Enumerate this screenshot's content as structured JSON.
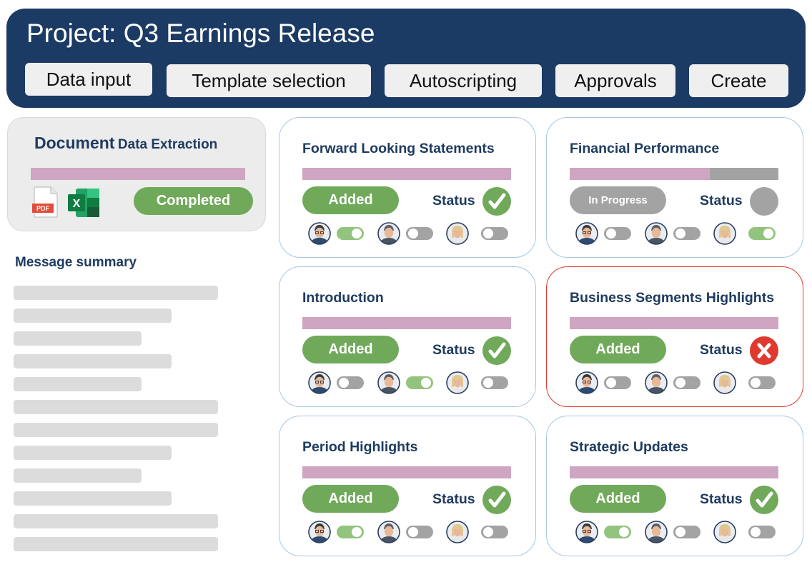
{
  "header": {
    "title": "Project: Q3 Earnings Release",
    "tabs": [
      {
        "label": "Data input"
      },
      {
        "label": "Template selection"
      },
      {
        "label": "Autoscripting"
      },
      {
        "label": "Approvals"
      },
      {
        "label": "Create"
      }
    ]
  },
  "document": {
    "title_main": "Document",
    "title_sub": "Data Extraction",
    "progress": 1.0,
    "file_icons": [
      "pdf-file-icon",
      "excel-file-icon"
    ],
    "pdf_label": "PDF",
    "xls_label": "X",
    "status_label": "Completed"
  },
  "message_summary": {
    "title": "Message summary",
    "placeholder_line_count": 12
  },
  "colors": {
    "header_bg": "#1b3a64",
    "title_text": "#1f3b60",
    "progress_fill": "#cfa6c1",
    "added_green": "#70a95a",
    "toggle_on": "#92c47d",
    "neutral_gray": "#a3a3a3",
    "error_red": "#e0392f",
    "card_border": "#a8c7e4"
  },
  "sections": [
    {
      "title": "Forward Looking Statements",
      "progress": 1.0,
      "pill_label": "Added",
      "pill_state": "added",
      "status_label": "Status",
      "status": "approved",
      "status_icon": "check-circle-icon",
      "reviewers": [
        {
          "avatar": "reviewer-1-avatar",
          "toggle_on": true
        },
        {
          "avatar": "reviewer-2-avatar",
          "toggle_on": false
        },
        {
          "avatar": "reviewer-3-avatar",
          "toggle_on": false
        }
      ]
    },
    {
      "title": "Financial Performance",
      "progress": 0.67,
      "pill_label": "In Progress",
      "pill_state": "progress",
      "status_label": "Status",
      "status": "pending",
      "status_icon": "pending-circle-icon",
      "reviewers": [
        {
          "avatar": "reviewer-1-avatar",
          "toggle_on": false
        },
        {
          "avatar": "reviewer-2-avatar",
          "toggle_on": false
        },
        {
          "avatar": "reviewer-3-avatar",
          "toggle_on": true
        }
      ]
    },
    {
      "title": "Introduction",
      "progress": 1.0,
      "pill_label": "Added",
      "pill_state": "added",
      "status_label": "Status",
      "status": "approved",
      "status_icon": "check-circle-icon",
      "reviewers": [
        {
          "avatar": "reviewer-1-avatar",
          "toggle_on": false
        },
        {
          "avatar": "reviewer-2-avatar",
          "toggle_on": true
        },
        {
          "avatar": "reviewer-3-avatar",
          "toggle_on": false
        }
      ]
    },
    {
      "title": "Business Segments Highlights",
      "progress": 1.0,
      "pill_label": "Added",
      "pill_state": "added",
      "status_label": "Status",
      "status": "rejected",
      "status_icon": "x-circle-icon",
      "reviewers": [
        {
          "avatar": "reviewer-1-avatar",
          "toggle_on": false
        },
        {
          "avatar": "reviewer-2-avatar",
          "toggle_on": false
        },
        {
          "avatar": "reviewer-3-avatar",
          "toggle_on": false
        }
      ]
    },
    {
      "title": "Period Highlights",
      "progress": 1.0,
      "pill_label": "Added",
      "pill_state": "added",
      "status_label": "Status",
      "status": "approved",
      "status_icon": "check-circle-icon",
      "reviewers": [
        {
          "avatar": "reviewer-1-avatar",
          "toggle_on": true
        },
        {
          "avatar": "reviewer-2-avatar",
          "toggle_on": false
        },
        {
          "avatar": "reviewer-3-avatar",
          "toggle_on": false
        }
      ]
    },
    {
      "title": "Strategic Updates",
      "progress": 1.0,
      "pill_label": "Added",
      "pill_state": "added",
      "status_label": "Status",
      "status": "approved",
      "status_icon": "check-circle-icon",
      "reviewers": [
        {
          "avatar": "reviewer-1-avatar",
          "toggle_on": true
        },
        {
          "avatar": "reviewer-2-avatar",
          "toggle_on": false
        },
        {
          "avatar": "reviewer-3-avatar",
          "toggle_on": false
        }
      ]
    }
  ]
}
